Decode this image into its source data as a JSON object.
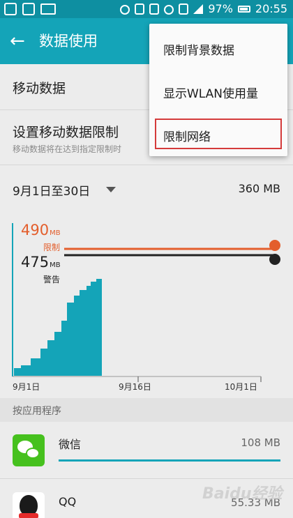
{
  "status_bar": {
    "battery": "97%",
    "time": "20:55",
    "icons": [
      "sim-icon",
      "storage-icon",
      "mail-icon",
      "alarm-icon",
      "lock-icon",
      "mute-icon",
      "wifi-icon",
      "sim1-icon",
      "signal-icon",
      "battery-icon"
    ]
  },
  "app_bar": {
    "title": "数据使用",
    "back_icon": "arrow-left-icon"
  },
  "settings": {
    "mobile_data": "移动数据",
    "limit_title": "设置移动数据限制",
    "limit_sub": "移动数据将在达到指定限制时"
  },
  "cycle": {
    "range": "9月1日至30日",
    "total": "360 MB"
  },
  "chart_data": {
    "type": "area",
    "limit": {
      "value": "490",
      "unit": "MB",
      "label": "限制"
    },
    "warning": {
      "value": "475",
      "unit": "MB",
      "label": "警告"
    },
    "x_ticks": [
      "9月1日",
      "9月16日",
      "10月1日"
    ],
    "colors": {
      "usage": "#14a4b8",
      "limit": "#e35e2c",
      "warning": "#222222"
    }
  },
  "section": {
    "title": "按应用程序"
  },
  "apps": [
    {
      "name": "微信",
      "size": "108 MB",
      "icon": "wechat-icon"
    },
    {
      "name": "QQ",
      "size": "55.33 MB",
      "icon": "qq-icon"
    }
  ],
  "menu": {
    "items": [
      "限制背景数据",
      "显示WLAN使用量",
      "限制网络"
    ],
    "highlighted": "限制网络"
  },
  "watermark": "Baidu经验"
}
